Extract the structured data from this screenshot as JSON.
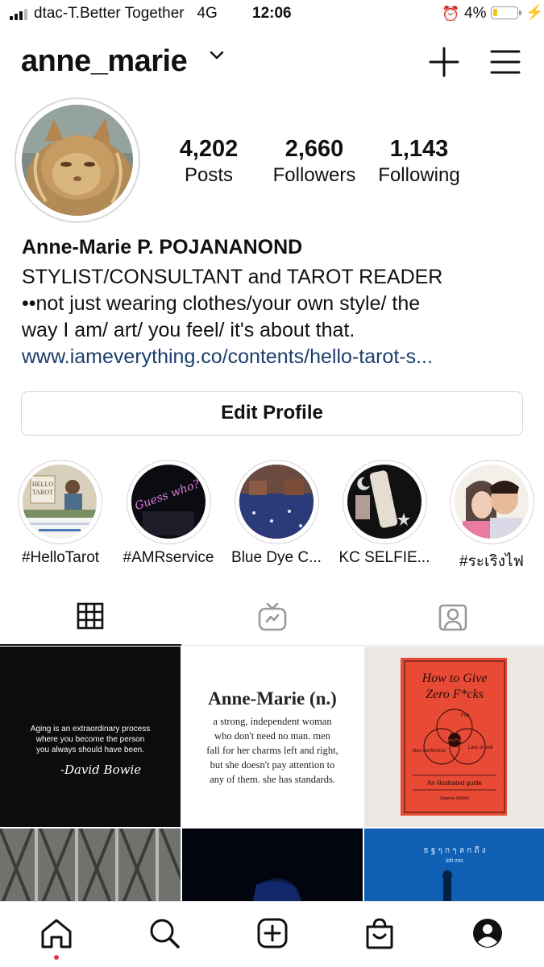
{
  "status_bar": {
    "carrier": "dtac-T.Better Together",
    "network": "4G",
    "time": "12:06",
    "battery_percent": "4%",
    "battery_level": 0.04
  },
  "header": {
    "username": "anne_marie",
    "icons": [
      "chevron-down-icon",
      "plus-icon",
      "menu-icon"
    ]
  },
  "profile": {
    "stats": [
      {
        "value": "4,202",
        "label": "Posts"
      },
      {
        "value": "2,660",
        "label": "Followers"
      },
      {
        "value": "1,143",
        "label": "Following"
      }
    ],
    "full_name": "Anne-Marie P. POJANANOND",
    "bio_lines": [
      "STYLIST/CONSULTANT and TAROT READER",
      "••not just wearing clothes/your own style/ the",
      "way I am/ art/ you feel/ it's about that."
    ],
    "link": "www.iameverything.co/contents/hello-tarot-s...",
    "edit_button": "Edit Profile"
  },
  "highlights": [
    {
      "label": "#HelloTarot"
    },
    {
      "label": "#AMRservice"
    },
    {
      "label": "Blue Dye C..."
    },
    {
      "label": "KC SELFIE..."
    },
    {
      "label": "#ระเริงไฟ"
    }
  ],
  "tabs": [
    "grid-icon",
    "igtv-icon",
    "tagged-icon"
  ],
  "posts": {
    "p1": {
      "line1": "Aging is an extraordinary process",
      "line2": "where you become the person",
      "line3": "you always should have been.",
      "signature": "-David Bowie"
    },
    "p2": {
      "title": "Anne-Marie (n.)",
      "lines": [
        "a strong, independent woman",
        "who don't need no man. men",
        "fall for her charms left and right,",
        "but she doesn't pay attention to",
        "any of them. she has standards."
      ]
    },
    "p3": {
      "title1": "How to Give",
      "title2": "Zero F*cks",
      "subtitle": "An illustrated guide",
      "author": "Stephen Wildish",
      "venn": [
        "Fun",
        "Not caring",
        "Lack of skill",
        "Zero f*cks"
      ],
      "venn_labels": [
        "Fun",
        "Non-conformist",
        "Lack of skill",
        "Zero f*cks"
      ]
    },
    "p6": {
      "text1": "ธ ฐ ๆ ก ๆ ล ก ถึ ง",
      "text2": "lofi mix"
    }
  },
  "bottom_nav": [
    "home-icon",
    "search-icon",
    "new-post-icon",
    "shop-icon",
    "profile-icon"
  ],
  "colors": {
    "link": "#1a3e6d",
    "notification_dot": "#e8344e",
    "battery": "#f3c623",
    "book": "#e84a35"
  }
}
